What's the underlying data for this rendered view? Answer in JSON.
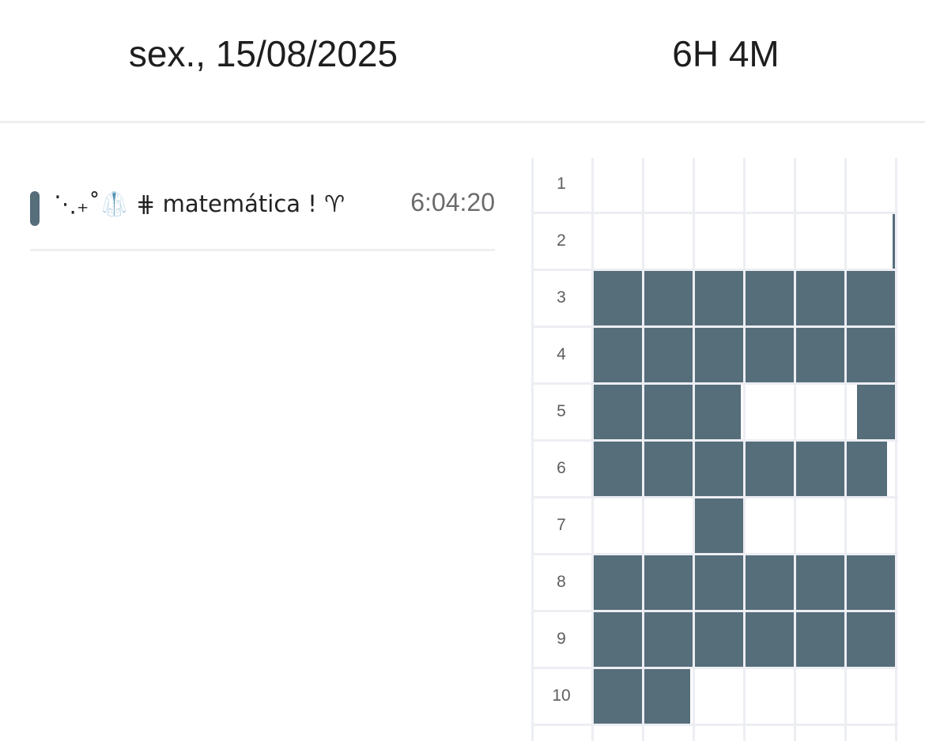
{
  "header": {
    "date": "sex., 15/08/2025",
    "total": "6H 4M"
  },
  "entries": [
    {
      "title": "⋱₊˚🥼 ⋕ 𝗆𝖺𝗍𝖾𝗆á𝗍𝗂𝖼𝖺 ! ♈︎",
      "duration": "6:04:20",
      "color": "#566d7a"
    }
  ],
  "timeline": {
    "hours": [
      "1",
      "2",
      "3",
      "4",
      "5",
      "6",
      "7",
      "8",
      "9",
      "10"
    ],
    "bar_color": "#566d7a",
    "filled_blocks": [
      {
        "hour": 2,
        "start_min": 59.6,
        "end_min": 60
      },
      {
        "hour": 3,
        "start_min": 0,
        "end_min": 60
      },
      {
        "hour": 4,
        "start_min": 0,
        "end_min": 60
      },
      {
        "hour": 5,
        "start_min": 0,
        "end_min": 29
      },
      {
        "hour": 5,
        "start_min": 52,
        "end_min": 60
      },
      {
        "hour": 6,
        "start_min": 0,
        "end_min": 58
      },
      {
        "hour": 7,
        "start_min": 20,
        "end_min": 30
      },
      {
        "hour": 8,
        "start_min": 0,
        "end_min": 60
      },
      {
        "hour": 9,
        "start_min": 0,
        "end_min": 60
      },
      {
        "hour": 10,
        "start_min": 0,
        "end_min": 19
      }
    ]
  }
}
